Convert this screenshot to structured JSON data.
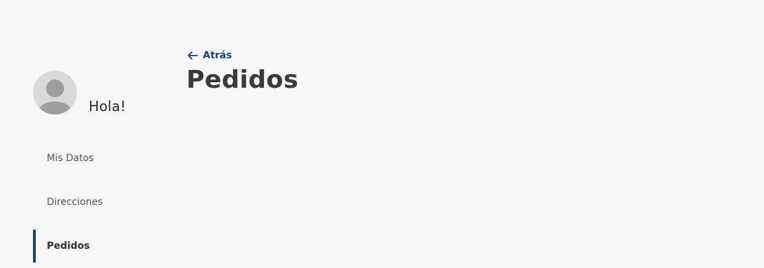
{
  "user": {
    "greeting": "Hola!",
    "avatar_icon": "user-placeholder-icon"
  },
  "sidebar": {
    "items": [
      {
        "label": "Mis Datos",
        "active": false
      },
      {
        "label": "Direcciones",
        "active": false
      },
      {
        "label": "Pedidos",
        "active": true
      }
    ]
  },
  "main": {
    "back_label": "Atrás",
    "back_icon": "arrow-left-icon",
    "title": "Pedidos"
  },
  "colors": {
    "background": "#f6f6f6",
    "accent": "#1a3d8a",
    "avatar_bg": "#d9d9d9",
    "avatar_fg": "#9e9e9e"
  }
}
